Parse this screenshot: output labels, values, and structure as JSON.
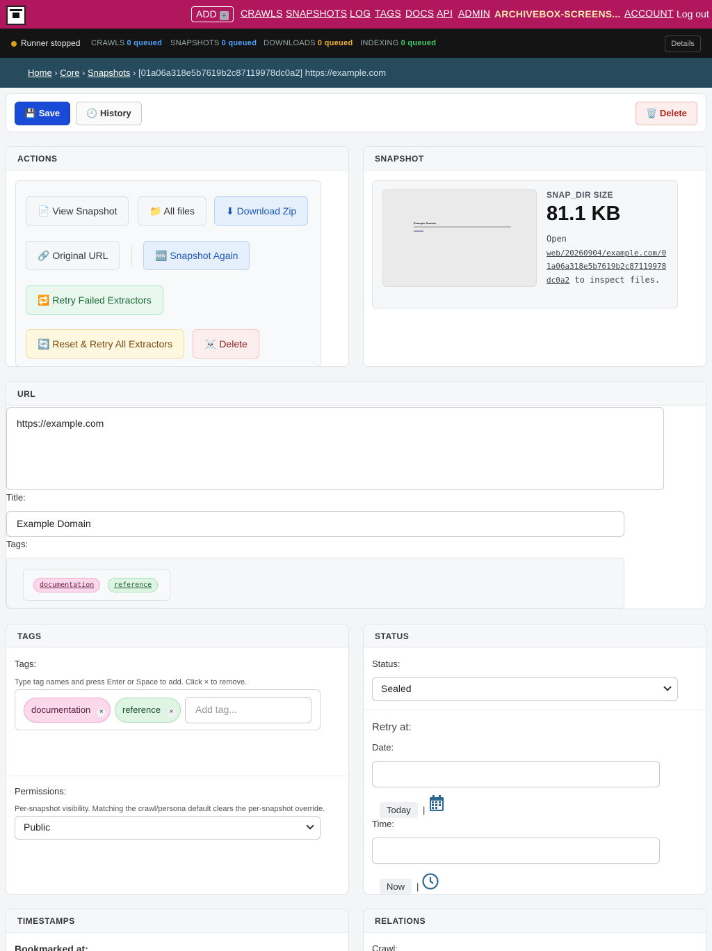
{
  "nav": {
    "add": "ADD",
    "links": [
      "CRAWLS",
      "SNAPSHOTS",
      "LOG",
      "TAGS",
      "DOCS",
      "API",
      "ADMIN"
    ],
    "brand": "ARCHIVEBOX-SCREENS...",
    "account": "ACCOUNT",
    "logout": "Log out"
  },
  "runner": {
    "status": "Runner stopped",
    "queues": [
      {
        "label": "CRAWLS",
        "value": "0 queued",
        "color": "#4da3ff"
      },
      {
        "label": "SNAPSHOTS",
        "value": "0 queued",
        "color": "#4da3ff"
      },
      {
        "label": "DOWNLOADS",
        "value": "0 queued",
        "color": "#f0b429"
      },
      {
        "label": "INDEXING",
        "value": "0 queued",
        "color": "#3ccf6a"
      }
    ],
    "details": "Details"
  },
  "breadcrumb": {
    "home": "Home",
    "core": "Core",
    "snapshots": "Snapshots",
    "current": "[01a06a318e5b7619b2c87119978dc0a2] https://example.com"
  },
  "toolbar": {
    "save": "💾 Save",
    "history": "🕘 History",
    "delete": "🗑️ Delete"
  },
  "actions": {
    "header": "ACTIONS",
    "view_snapshot": "📄 View Snapshot",
    "all_files": "📁 All files",
    "download_zip": "⬇ Download Zip",
    "original_url": "🔗 Original URL",
    "snapshot_again": "🆕 Snapshot Again",
    "retry_failed": "🔁 Retry Failed Extractors",
    "reset_retry": "🔄 Reset & Retry All Extractors",
    "delete": "☠️ Delete"
  },
  "snapshot": {
    "header": "SNAPSHOT",
    "thumb_title": "Example Domain",
    "size_label": "SNAP_DIR SIZE",
    "size_value": "81.1 KB",
    "open_prefix": "Open",
    "open_path": "web/20260904/example.com/01a06a318e5b7619b2c87119978dc0a2",
    "open_suffix": "to inspect files."
  },
  "url_section": {
    "header": "URL",
    "url_value": "https://example.com",
    "title_label": "Title:",
    "title_value": "Example Domain",
    "tags_label": "Tags:",
    "tags": [
      "documentation",
      "reference"
    ]
  },
  "tags_card": {
    "header": "TAGS",
    "label": "Tags:",
    "help": "Type tag names and press Enter or Space to add. Click × to remove.",
    "chips": [
      "documentation",
      "reference"
    ],
    "remove_symbol": "×",
    "add_placeholder": "Add tag...",
    "permissions_label": "Permissions:",
    "permissions_help": "Per-snapshot visibility. Matching the crawl/persona default clears the per-snapshot override.",
    "permissions_value": "Public"
  },
  "status_card": {
    "header": "STATUS",
    "status_label": "Status:",
    "status_value": "Sealed",
    "retry_label": "Retry at:",
    "date_label": "Date:",
    "today": "Today",
    "time_label": "Time:",
    "now": "Now",
    "pipe": "|"
  },
  "timestamps": {
    "header": "TIMESTAMPS",
    "bookmarked_label": "Bookmarked at:"
  },
  "relations": {
    "header": "RELATIONS",
    "crawl_label": "Crawl:"
  }
}
